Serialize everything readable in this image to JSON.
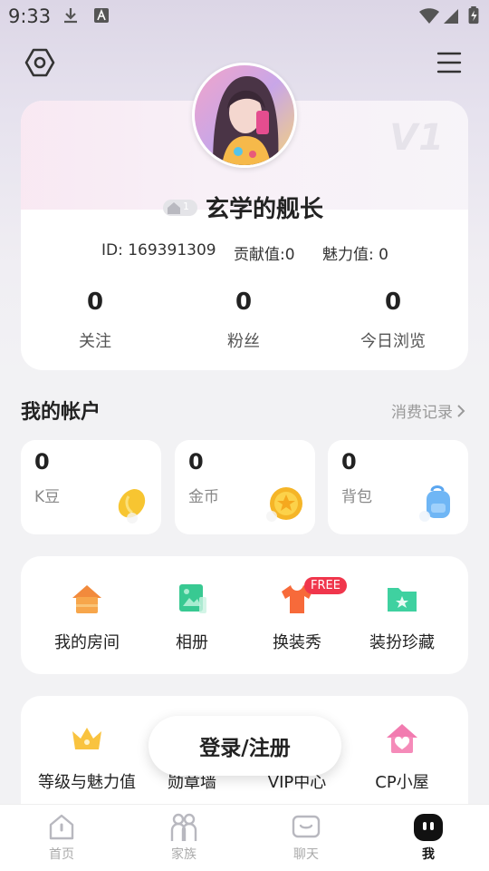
{
  "status_bar": {
    "time": "9:33",
    "icons": [
      "download-icon",
      "keyboard-a-icon",
      "wifi-icon",
      "signal-icon",
      "battery-icon"
    ]
  },
  "header": {
    "left_icon": "hexagon-settings-icon",
    "right_icon": "menu-icon"
  },
  "profile": {
    "vip_mark": "V1",
    "level_badge": "1",
    "username": "玄学的舰长",
    "id_text": "ID: 169391309",
    "contribution_text": "贡献值:0",
    "charm_text": "魅力值: 0",
    "counts": [
      {
        "value": "0",
        "label": "关注"
      },
      {
        "value": "0",
        "label": "粉丝"
      },
      {
        "value": "0",
        "label": "今日浏览"
      }
    ]
  },
  "account": {
    "title": "我的帐户",
    "records_link": "消费记录",
    "cards": [
      {
        "value": "0",
        "label": "K豆",
        "icon": "bean-icon"
      },
      {
        "value": "0",
        "label": "金币",
        "icon": "coin-icon"
      },
      {
        "value": "0",
        "label": "背包",
        "icon": "backpack-icon"
      }
    ]
  },
  "features": [
    {
      "label": "我的房间",
      "icon": "house-icon"
    },
    {
      "label": "相册",
      "icon": "photo-album-icon"
    },
    {
      "label": "换装秀",
      "icon": "tshirt-icon",
      "tag": "FREE"
    },
    {
      "label": "装扮珍藏",
      "icon": "folder-star-icon"
    }
  ],
  "features2": [
    {
      "label": "等级与魅力值",
      "icon": "crown-icon"
    },
    {
      "label": "勋章墙",
      "icon": "medal-icon"
    },
    {
      "label": "VIP中心",
      "icon": "vip-icon"
    },
    {
      "label": "CP小屋",
      "icon": "heart-house-icon"
    }
  ],
  "login_button": "登录/注册",
  "nav": [
    {
      "label": "首页",
      "icon": "home-icon",
      "active": false
    },
    {
      "label": "家族",
      "icon": "family-icon",
      "active": false
    },
    {
      "label": "聊天",
      "icon": "chat-icon",
      "active": false
    },
    {
      "label": "我",
      "icon": "me-icon",
      "active": true
    }
  ],
  "colors": {
    "accent_orange": "#f5a043",
    "accent_green": "#3fd1a0",
    "free_red": "#f0364c",
    "pink": "#f58bb9"
  }
}
